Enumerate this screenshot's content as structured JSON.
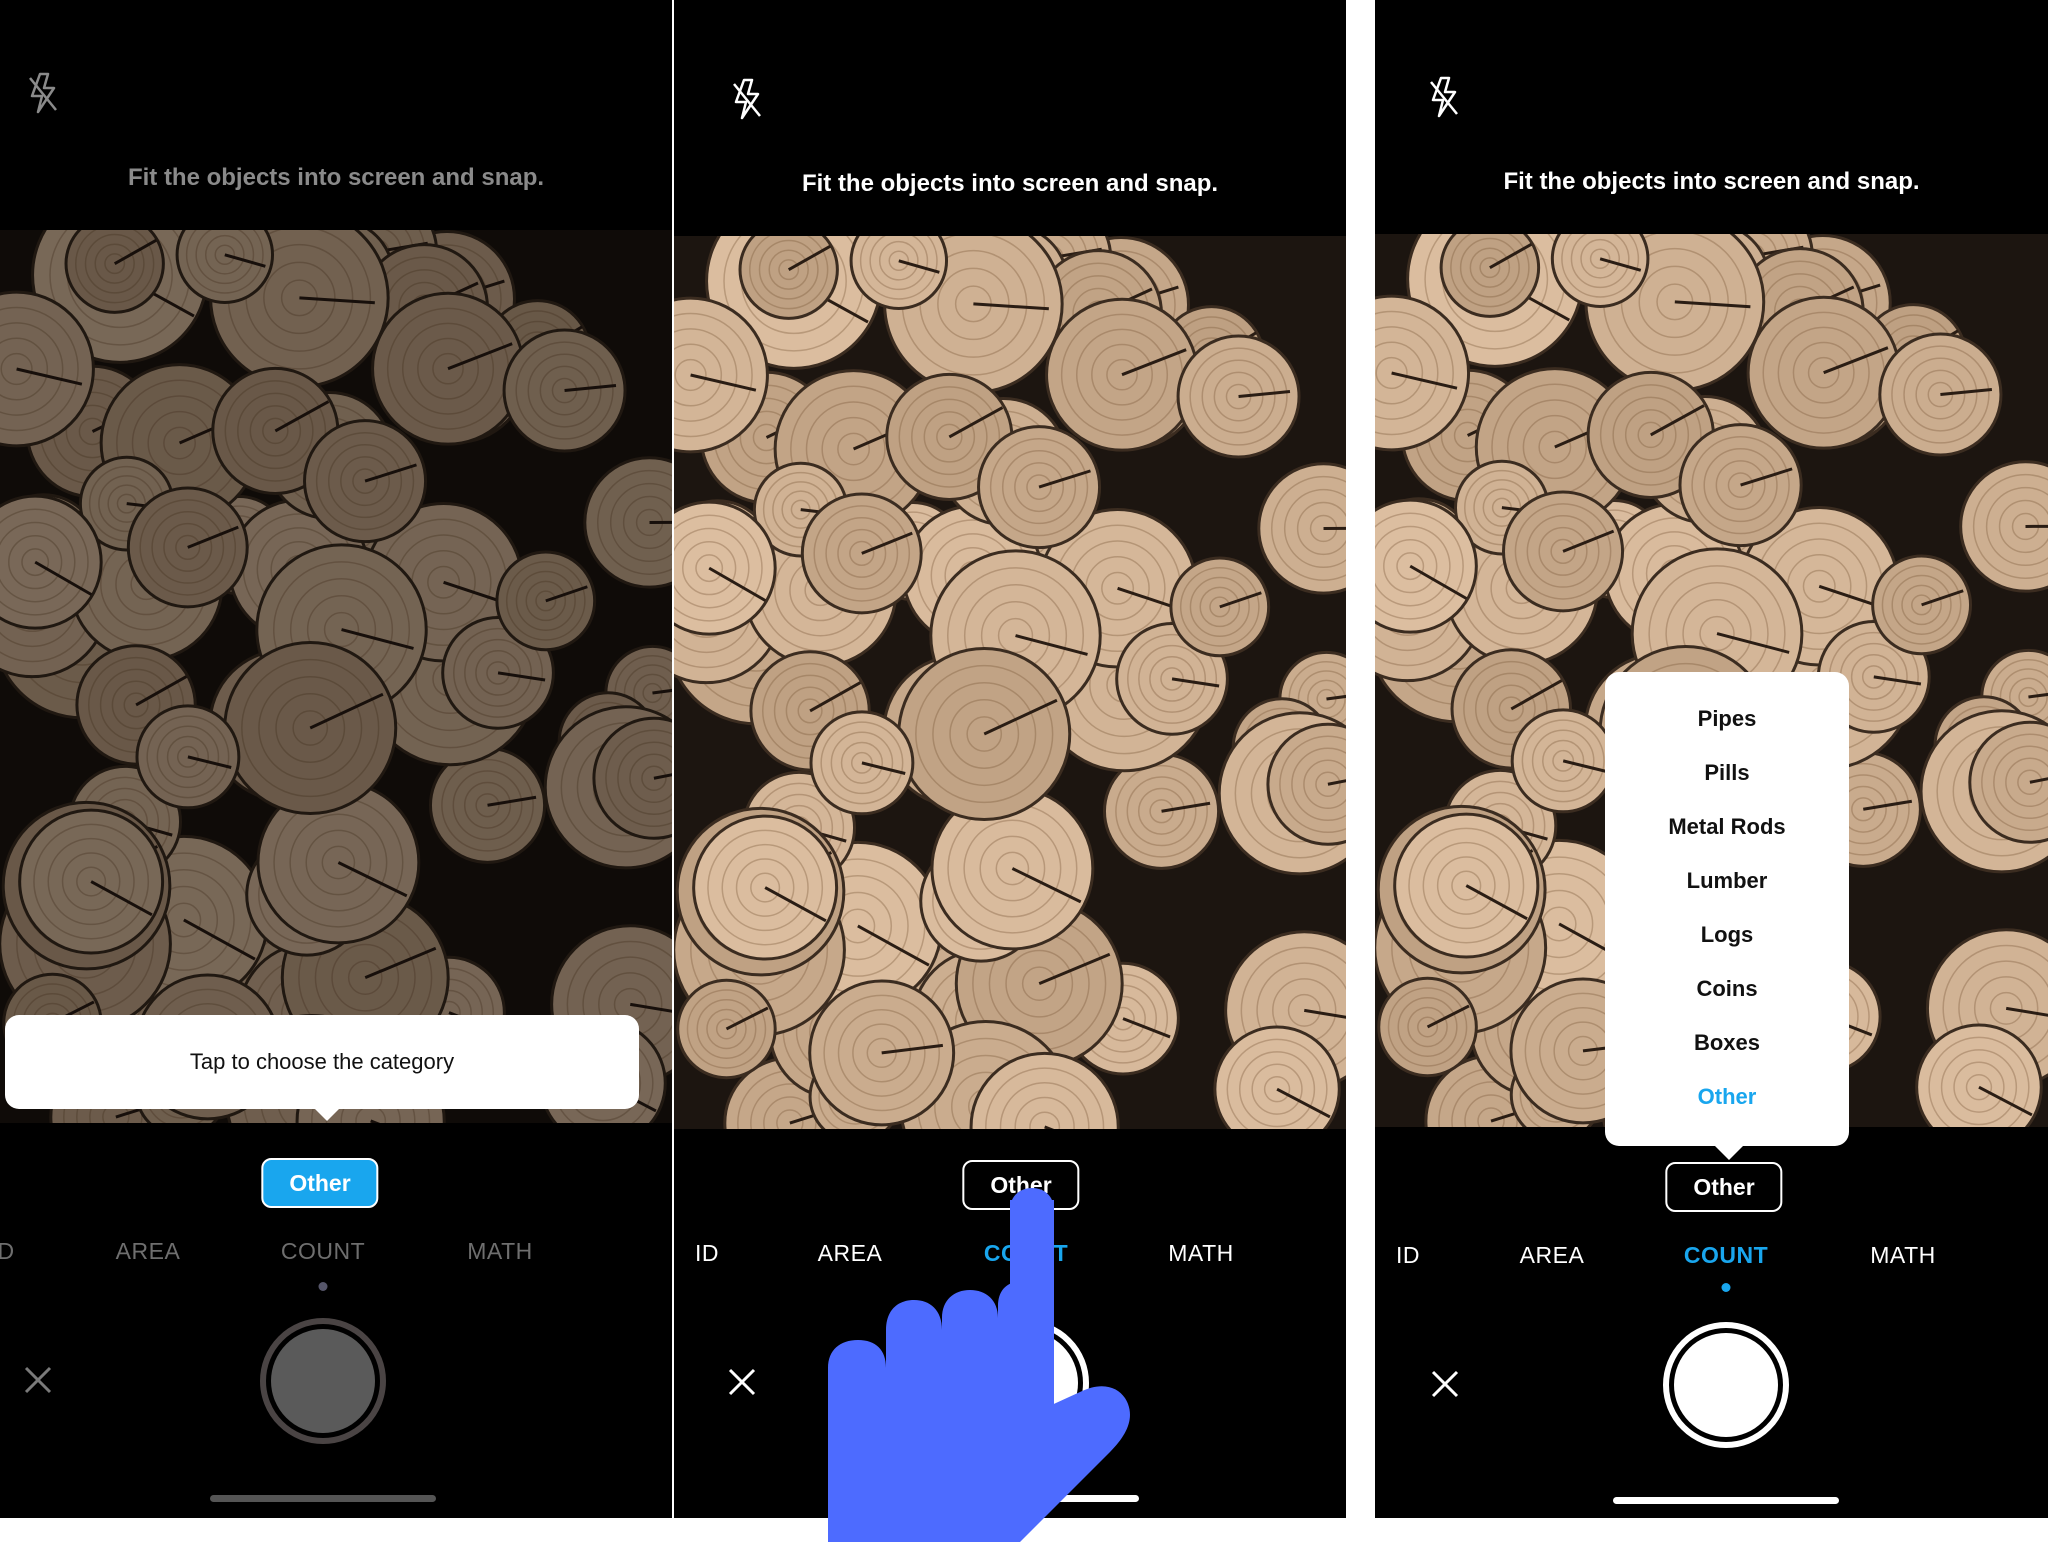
{
  "hint_text": "Fit the objects into screen and snap.",
  "tooltip_text": "Tap to choose the category",
  "category_value": "Other",
  "modes": {
    "id": "ID",
    "id_partial": "D",
    "area": "AREA",
    "count": "COUNT",
    "math": "MATH"
  },
  "category_menu": {
    "items": [
      "Pipes",
      "Pills",
      "Metal Rods",
      "Lumber",
      "Logs",
      "Coins",
      "Boxes",
      "Other"
    ],
    "selected": "Other"
  },
  "colors": {
    "accent": "#19a6ee",
    "hand": "#4d6bff",
    "background": "#000000"
  },
  "icons": [
    "flash-off-icon",
    "close-icon",
    "shutter-button",
    "pointing-hand-icon"
  ]
}
